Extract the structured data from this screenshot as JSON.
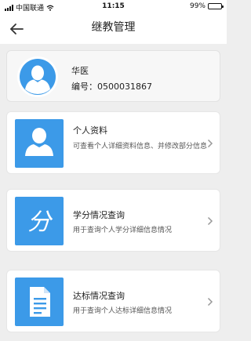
{
  "status_bar": {
    "carrier": "中国联通",
    "time": "11:15",
    "battery": "99%",
    "battery_level": 0.99,
    "icons": [
      "signal-icon",
      "wifi-icon",
      "battery-icon"
    ]
  },
  "nav": {
    "title": "继教管理",
    "back_icon": "back-arrow-icon"
  },
  "profile": {
    "name": "华医",
    "id_label": "编号：0500031867",
    "avatar_icon": "user-avatar-icon"
  },
  "cards": [
    {
      "title": "个人资料",
      "description": "可查看个人详细资料信息、并修改部分信息",
      "icon": "person-icon"
    },
    {
      "title": "学分情况查询",
      "description": "用于查询个人学分详细信息情况",
      "icon": "credit-fen-icon",
      "glyph": "分"
    },
    {
      "title": "达标情况查询",
      "description": "用于查询个人达标详细信息情况",
      "icon": "document-icon"
    }
  ],
  "colors": {
    "accent": "#3c9ae8",
    "background": "#eeeeee",
    "card": "#ffffff"
  }
}
